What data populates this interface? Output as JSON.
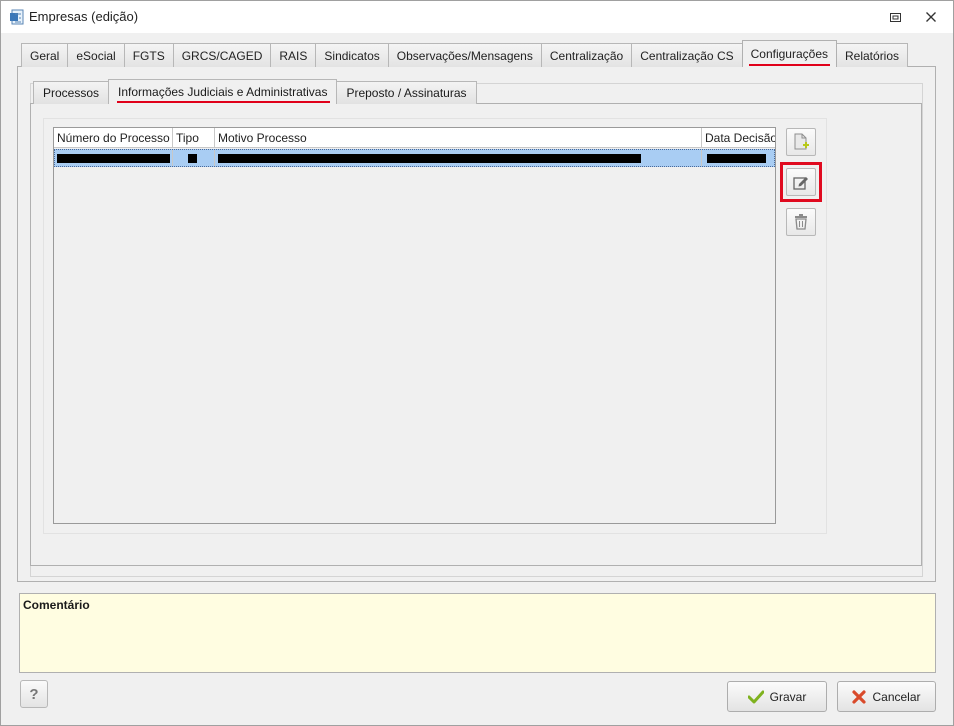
{
  "window": {
    "title": "Empresas (edição)"
  },
  "top_tabs": [
    {
      "label": "Geral"
    },
    {
      "label": "eSocial"
    },
    {
      "label": "FGTS"
    },
    {
      "label": "GRCS/CAGED"
    },
    {
      "label": "RAIS"
    },
    {
      "label": "Sindicatos"
    },
    {
      "label": "Observações/Mensagens"
    },
    {
      "label": "Centralização"
    },
    {
      "label": "Centralização CS"
    },
    {
      "label": "Configurações",
      "active": true
    },
    {
      "label": "Relatórios"
    }
  ],
  "sub_tabs": [
    {
      "label": "Processos"
    },
    {
      "label": "Informações Judiciais e Administrativas",
      "active": true
    },
    {
      "label": "Preposto / Assinaturas"
    }
  ],
  "grid": {
    "columns": [
      "Número do Processo",
      "Tipo",
      "Motivo Processo",
      "Data Decisão"
    ],
    "rows": [
      {
        "redacted": true,
        "selected": true
      }
    ]
  },
  "side_buttons": [
    {
      "icon": "add-document-icon",
      "label": "add"
    },
    {
      "icon": "edit-icon",
      "label": "edit",
      "highlighted": true
    },
    {
      "icon": "trash-icon",
      "label": "delete"
    }
  ],
  "comment": {
    "label": "Comentário",
    "value": ""
  },
  "footer": {
    "help_label": "?",
    "save_label": "Gravar",
    "cancel_label": "Cancelar"
  },
  "colors": {
    "accent_underline": "#e0001a",
    "selection": "#a9cdf3",
    "comment_bg": "#fffde1"
  }
}
